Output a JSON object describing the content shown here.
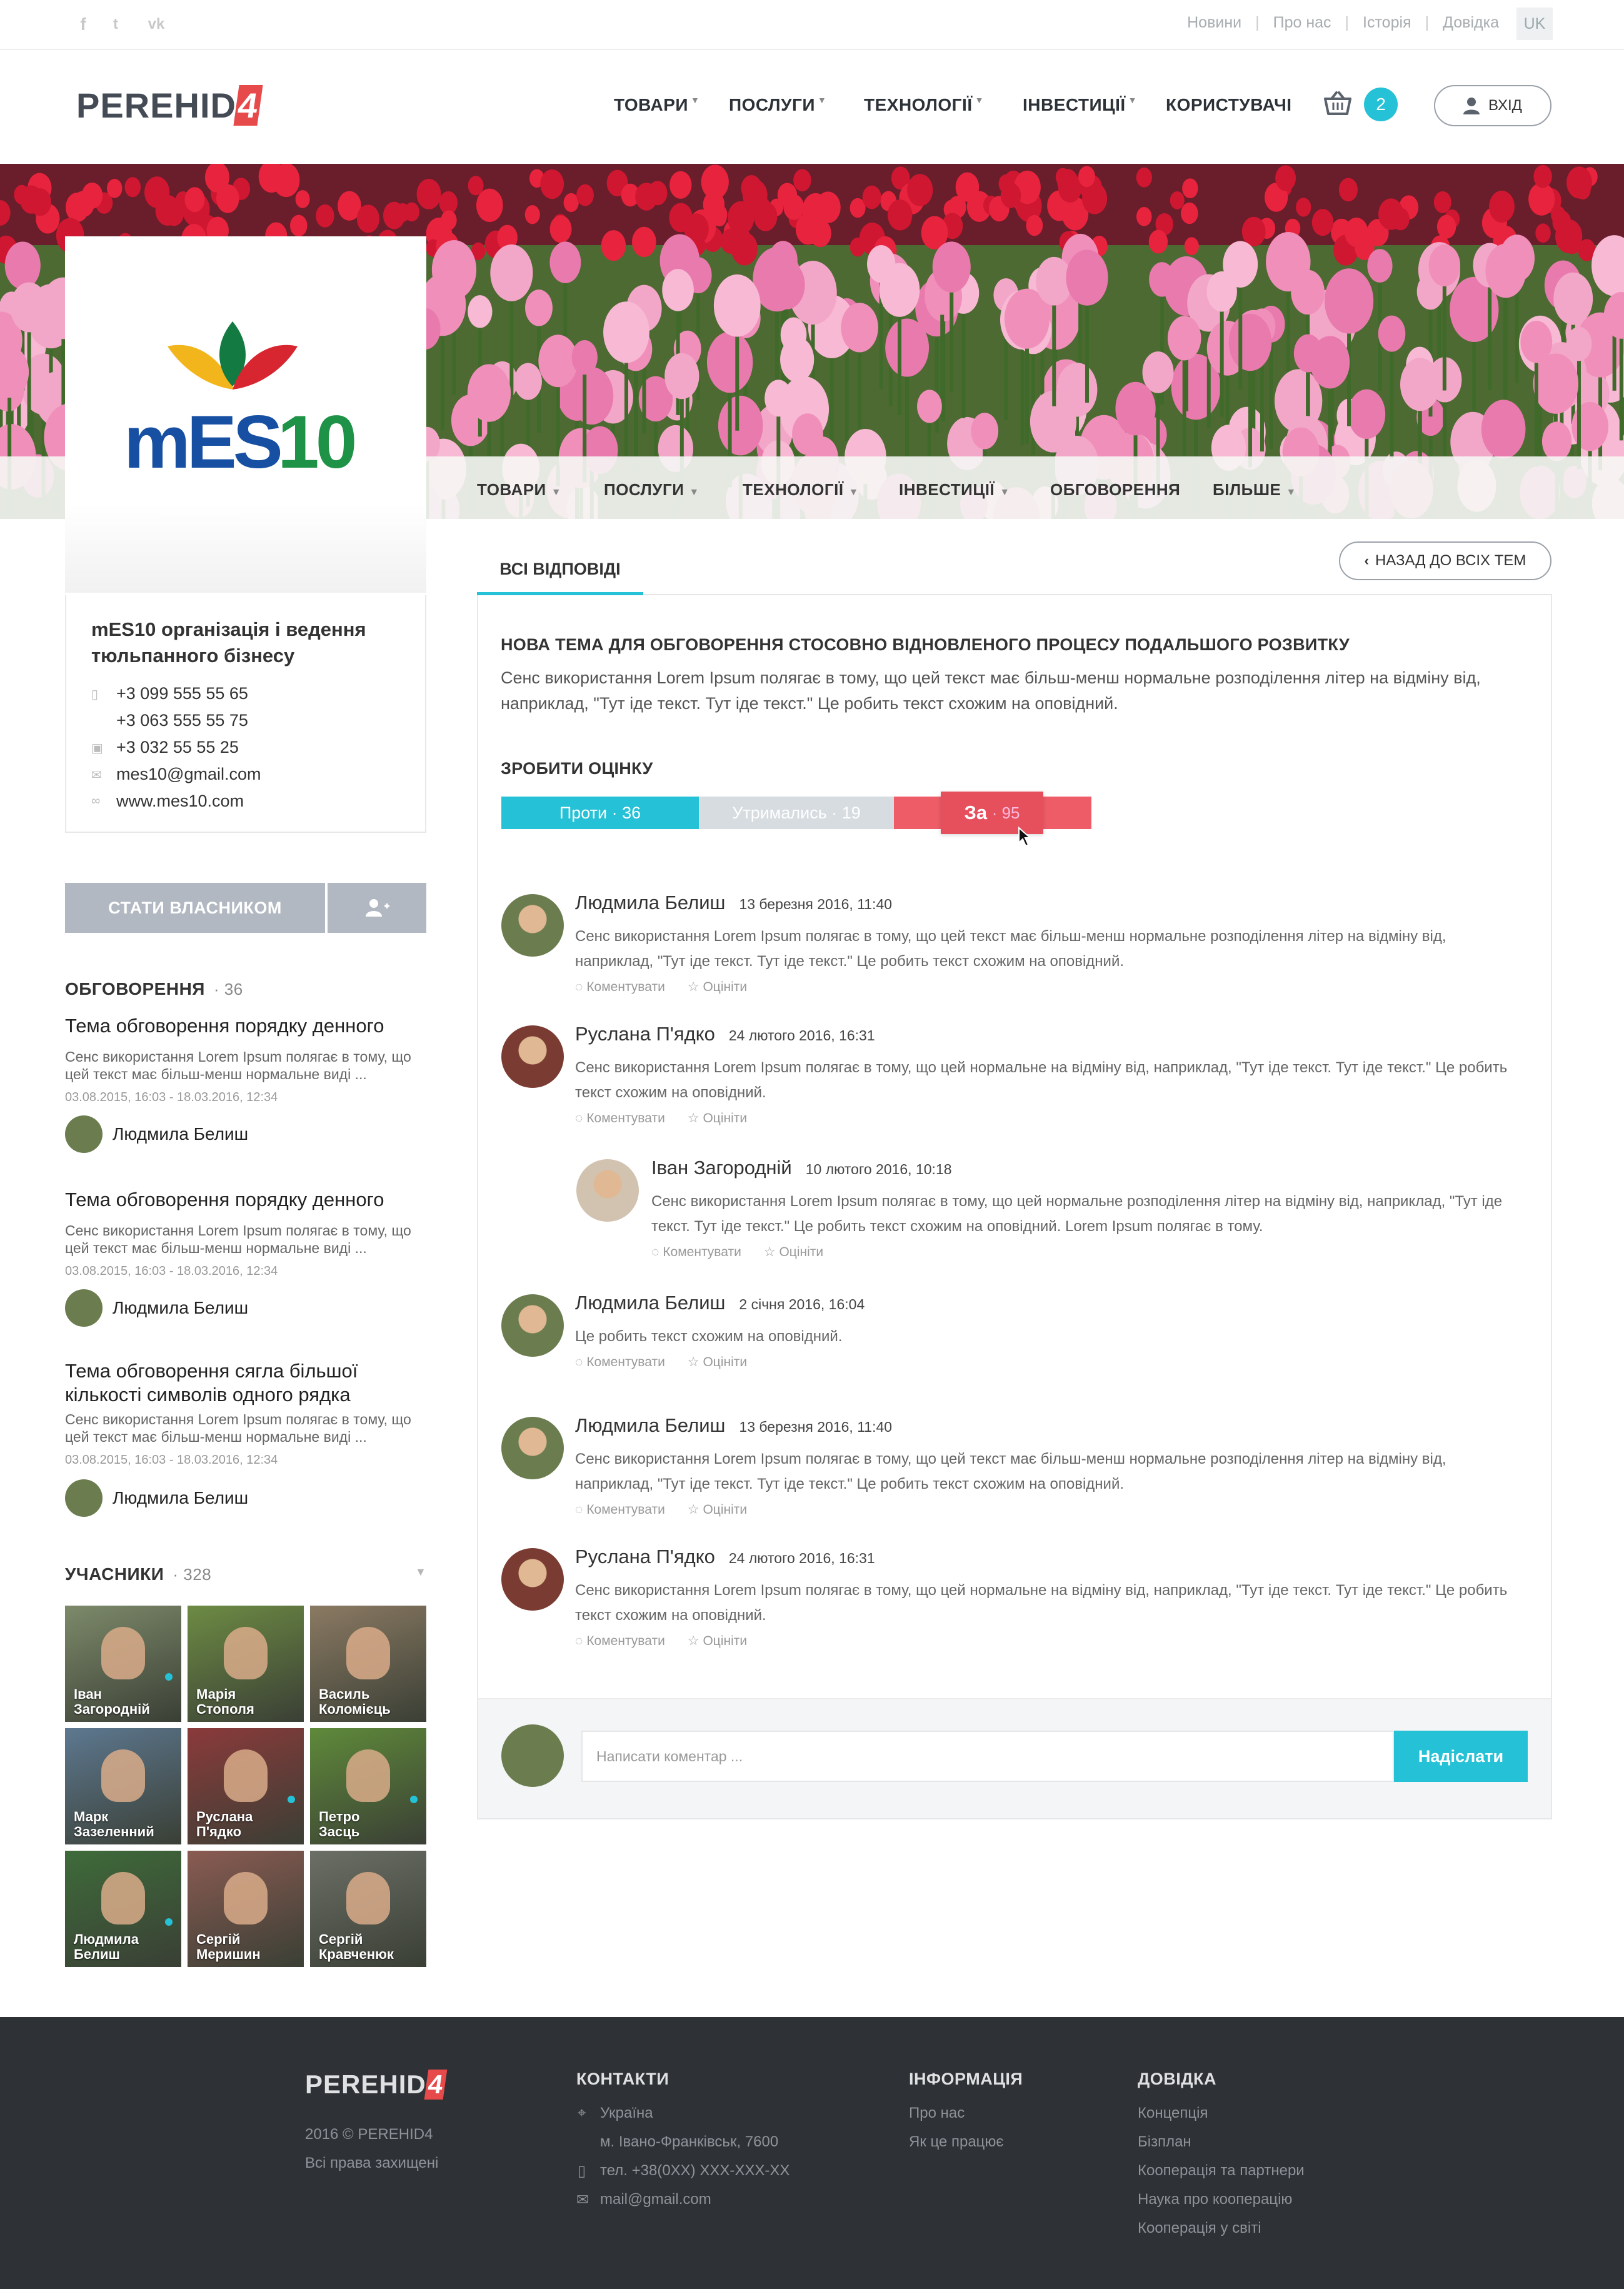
{
  "topbar": {
    "social": [
      "f",
      "t",
      "vk"
    ],
    "links": [
      "Новини",
      "Про нас",
      "Історія",
      "Довідка"
    ],
    "lang": "UK"
  },
  "header": {
    "logo_text": "PEREHID",
    "logo_mark": "4",
    "nav": [
      "ТОВАРИ",
      "ПОСЛУГИ",
      "ТЕХНОЛОГІЇ",
      "ІНВЕСТИЦІЇ",
      "КОРИСТУВАЧІ"
    ],
    "cart_count": "2",
    "login_label": "ВХІД"
  },
  "subnav": [
    "ТОВАРИ",
    "ПОСЛУГИ",
    "ТЕХНОЛОГІЇ",
    "ІНВЕСТИЦІЇ",
    "ОБГОВОРЕННЯ",
    "БІЛЬШЕ"
  ],
  "org": {
    "logo_text": "mES10",
    "name": "mES10 організація і ведення тюльпанного бізнесу",
    "phones": [
      "+3 099  555 55 65",
      "+3 063 555 55 75"
    ],
    "fax": "+3 032 55 55 25",
    "email": "mes10@gmail.com",
    "website": "www.mes10.com",
    "owner_button": "СТАТИ ВЛАСНИКОМ"
  },
  "discussions": {
    "heading": "ОБГОВОРЕННЯ",
    "count": "· 36",
    "topics": [
      {
        "title": "Тема обговорення порядку денного",
        "text": "Сенс використання Lorem Ipsum полягає в тому, що цей текст має більш-менш нормальне виді ...",
        "date": "03.08.2015, 16:03  -  18.03.2016, 12:34",
        "author": "Людмила Белиш"
      },
      {
        "title": "Тема обговорення порядку денного",
        "text": "Сенс використання Lorem Ipsum полягає в тому, що цей текст має більш-менш нормальне виді ...",
        "date": "03.08.2015, 16:03  -  18.03.2016, 12:34",
        "author": "Людмила Белиш"
      },
      {
        "title": "Тема обговорення сягла більшої кількості символів одного рядка",
        "text": "Сенс використання Lorem Ipsum полягає в тому, що цей текст має більш-менш нормальне виді ...",
        "date": "03.08.2015, 16:03  -  18.03.2016, 12:34",
        "author": "Людмила Белиш"
      }
    ]
  },
  "members": {
    "heading": "УЧАСНИКИ",
    "count": "· 328",
    "list": [
      {
        "first": "Іван",
        "last": "Загородній"
      },
      {
        "first": "Марія",
        "last": "Стополя"
      },
      {
        "first": "Василь",
        "last": "Коломієць"
      },
      {
        "first": "Марк",
        "last": "Зазеленний"
      },
      {
        "first": "Руслана",
        "last": "П'ядко"
      },
      {
        "first": "Петро",
        "last": "Засць"
      },
      {
        "first": "Людмила",
        "last": "Белиш"
      },
      {
        "first": "Сергій",
        "last": "Меришин"
      },
      {
        "first": "Сергій",
        "last": "Кравченюк"
      }
    ]
  },
  "main": {
    "tab": "ВСІ ВІДПОВІДІ",
    "back_button": "НАЗАД ДО ВСІХ ТЕМ",
    "topic_title": "НОВА ТЕМА ДЛЯ ОБГОВОРЕННЯ СТОСОВНО ВІДНОВЛЕНОГО ПРОЦЕСУ ПОДАЛЬШОГО РОЗВИТКУ",
    "topic_text": "Сенс використання Lorem Ipsum полягає в тому, що цей текст має більш-менш нормальне розподілення літер на відміну від, наприклад, \"Тут іде текст. Тут іде текст.\" Це робить текст схожим на оповідний.",
    "rate_heading": "ЗРОБИТИ ОЦІНКУ",
    "votes": {
      "against_label": "Проти · 36",
      "abstain_label": "Утримались · 19",
      "for_label": "За",
      "for_count": "· 95"
    },
    "comment_actions": {
      "reply": "Коментувати",
      "rate": "Оцініти"
    },
    "comments": [
      {
        "name": "Людмила Белиш",
        "date": "13 березня 2016, 11:40",
        "text": "Сенс використання Lorem Ipsum полягає в тому, що цей текст має більш-менш нормальне розподілення літер на відміну від, наприклад, \"Тут іде текст. Тут іде текст.\" Це робить текст схожим на оповідний."
      },
      {
        "name": "Руслана П'ядко",
        "date": "24 лютого 2016, 16:31",
        "text": "Сенс використання Lorem Ipsum полягає в тому, що цей  нормальне на відміну від, наприклад, \"Тут іде текст. Тут іде текст.\" Це робить текст схожим на оповідний."
      },
      {
        "name": "Іван Загородній",
        "date": "10 лютого 2016, 10:18",
        "text": "Сенс використання Lorem Ipsum полягає в тому, що цей  нормальне розподілення літер на відміну від, наприклад, \"Тут іде текст. Тут іде текст.\" Це робить текст схожим на оповідний. Lorem Ipsum полягає в тому."
      },
      {
        "name": "Людмила Белиш",
        "date": "2 січня 2016, 16:04",
        "text": "Це робить текст схожим на оповідний."
      },
      {
        "name": "Людмила Белиш",
        "date": "13 березня 2016, 11:40",
        "text": "Сенс використання Lorem Ipsum полягає в тому, що цей текст має більш-менш нормальне розподілення літер на відміну від, наприклад, \"Тут іде текст. Тут іде текст.\" Це робить текст схожим на оповідний."
      },
      {
        "name": "Руслана П'ядко",
        "date": "24 лютого 2016, 16:31",
        "text": "Сенс використання Lorem Ipsum полягає в тому, що цей  нормальне на відміну від, наприклад, \"Тут іде текст. Тут іде текст.\" Це робить текст схожим на оповідний."
      }
    ],
    "comment_placeholder": "Написати коментар ...",
    "send_label": "Надіслати"
  },
  "footer": {
    "logo_text": "PEREHID",
    "logo_mark": "4",
    "copyright": "2016 © PEREHID4",
    "rights": "Всі права захищені",
    "contacts_heading": "КОНТАКТИ",
    "country": "Україна",
    "city": "м. Івано-Франківськ, 7600",
    "phone": "тел. +38(0XX) XXX-XXX-XX",
    "email": "mail@gmail.com",
    "info_heading": "ІНФОРМАЦІЯ",
    "info_links": [
      "Про нас",
      "Як це працює"
    ],
    "help_heading": "ДОВІДКА",
    "help_links": [
      "Концепція",
      "Бізплан",
      "Кооперація та партнери",
      "Наука про кооперацію",
      "Кооперація у світі"
    ]
  },
  "colors": {
    "accent": "#25c1d6",
    "vote_for": "#ee5c68",
    "vote_abstain": "#d7dce1",
    "footer_bg": "#2e3135",
    "logo_blue": "#1750a3",
    "logo_green": "#1e9246"
  }
}
